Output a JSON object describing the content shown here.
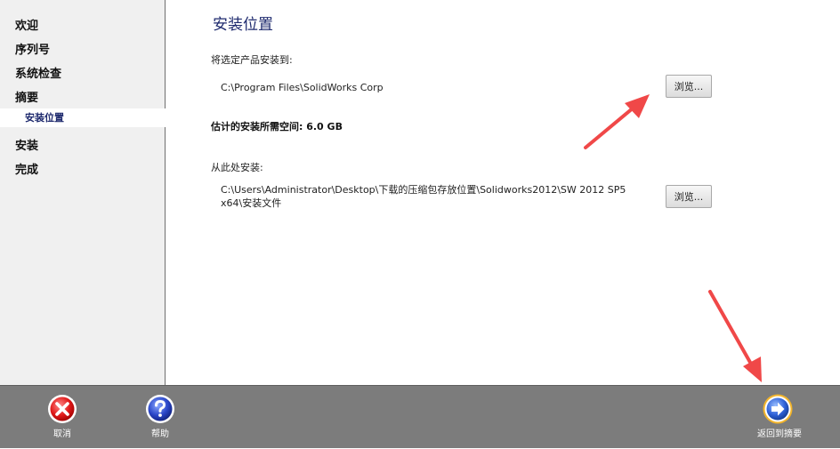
{
  "sidebar": {
    "items": [
      {
        "label": "欢迎"
      },
      {
        "label": "序列号"
      },
      {
        "label": "系统检查"
      },
      {
        "label": "摘要"
      },
      {
        "label": "安装位置"
      },
      {
        "label": "安装"
      },
      {
        "label": "完成"
      }
    ],
    "active_index": 4
  },
  "main": {
    "title": "安装位置",
    "install_to": {
      "label": "将选定产品安装到:",
      "path": "C:\\Program Files\\SolidWorks Corp",
      "browse_label": "浏览..."
    },
    "space_required": "估计的安装所需空间: 6.0 GB",
    "install_from": {
      "label": "从此处安装:",
      "path_line1": "C:\\Users\\Administrator\\Desktop\\下载的压缩包存放位置\\Solidworks2012\\SW 2012 SP5",
      "path_line2": "x64\\安装文件",
      "browse_label": "浏览..."
    }
  },
  "footer": {
    "cancel_label": "取消",
    "help_label": "帮助",
    "back_label": "返回到摘要"
  },
  "colors": {
    "sidebar_bg": "#f0f0f0",
    "title": "#1e2a6e",
    "footer_bg": "#7c7c7c",
    "annotation_arrow": "#f04848"
  },
  "icons": {
    "cancel": "red-x-circle-icon",
    "help": "blue-question-circle-icon",
    "back": "blue-arrow-right-circle-icon"
  }
}
